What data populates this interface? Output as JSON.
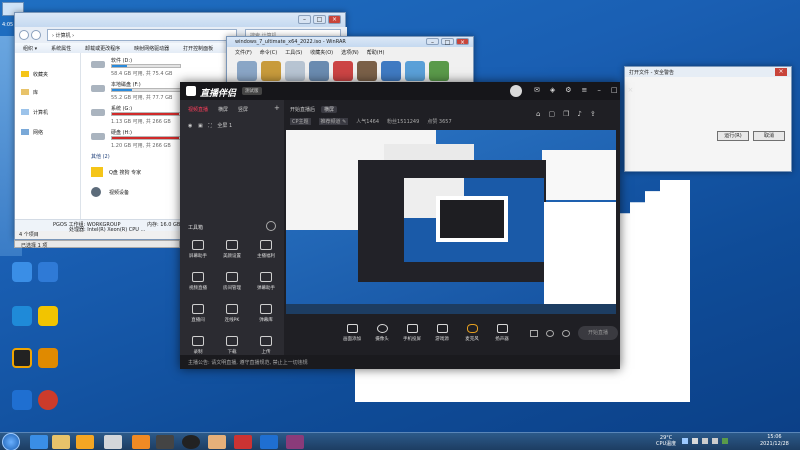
{
  "desktop": {
    "top_icon_label": "4:05",
    "icons": [
      {
        "label": "",
        "color": "#3a8ee6"
      },
      {
        "label": "",
        "color": "#2f7ad6"
      },
      {
        "label": "",
        "color": "#2b8a3e"
      },
      {
        "label": "",
        "color": "#f2a900"
      },
      {
        "label": "",
        "color": "#222222"
      },
      {
        "label": "",
        "color": "#e08a00"
      },
      {
        "label": "",
        "color": "#1f6fd1"
      },
      {
        "label": "",
        "color": "#cc3b2b"
      }
    ]
  },
  "explorer": {
    "address": "› 计算机 ›",
    "search_placeholder": "搜索 计算机",
    "menu": [
      "组织 ▾",
      "系统属性",
      "卸载或更改程序",
      "映射网络驱动器",
      "打开控制面板"
    ],
    "sidebar": [
      "收藏夹",
      "库",
      "计算机",
      "网络"
    ],
    "drives": [
      {
        "name": "软件 (D:)",
        "size": "58.4 GB 可用, 共 75.4 GB",
        "fill": 0.22,
        "bar": "#2a8adb"
      },
      {
        "name": "本地磁盘 (F:)",
        "size": "55.2 GB 可用, 共 77.7 GB",
        "fill": 0.29,
        "bar": "#2a8adb"
      },
      {
        "name": "系统 (G:)",
        "size": "1.13 GB 可用, 共 266 GB",
        "fill": 0.99,
        "bar": "#d02a2a"
      },
      {
        "name": "硬盘 (H:)",
        "size": "1.20 GB 可用, 共 266 GB",
        "fill": 0.99,
        "bar": "#d02a2a"
      }
    ],
    "other_section": "其他 (2)",
    "other": [
      "Q盘 搜狗 专家",
      "视频设备"
    ],
    "pc_name": "PGOS  工作组: WORKGROUP",
    "pc_cpu": "处理器: Intel(R) Xeon(R) CPU ...",
    "pc_mem": "内存: 16.0 GB",
    "status_top": "4 个项目",
    "status_bottom": "已选择 1 项"
  },
  "winrar": {
    "title": "windows_7_ultimate_x64_2022.iso - WinRAR",
    "menu": [
      "文件(F)",
      "命令(C)",
      "工具(S)",
      "收藏夹(O)",
      "选项(N)",
      "帮助(H)"
    ],
    "tools": [
      "添加",
      "解压到",
      "测试",
      "查看",
      "删除",
      "查找",
      "向导",
      "信息",
      "修复",
      "自解压格式"
    ]
  },
  "dialog": {
    "title": "打开文件 - 安全警告",
    "ok": "运行(R)",
    "cancel": "取消"
  },
  "zhibo": {
    "brand": "直播伴侣",
    "version": "测试版",
    "scene_tabs": [
      "视频直播",
      "横屏",
      "竖屏"
    ],
    "left_small": [
      "全屏 1"
    ],
    "section": "工具箱",
    "tools": [
      "屏幕助手",
      "美颜设置",
      "主播福利",
      "视频直播",
      "房间管理",
      "弹幕助手",
      "直播间",
      "连线PK",
      "弹幕库",
      "录制",
      "下载",
      "上传"
    ],
    "title_info": "开始直播后",
    "tag": "横屏",
    "room_info": [
      "CP主题",
      "推荐频道 ✎",
      "人气1464",
      "粉丝1511249",
      "点赞 3657"
    ],
    "bottom_tools": [
      "画面添加",
      "摄像头",
      "手机投屏",
      "游戏源",
      "麦克风",
      "扬声器"
    ],
    "start_button": "开始直播",
    "footer": "主播公告: 请文明直播, 遵守直播规范, 禁止上一切违规"
  },
  "taskbar": {
    "clock_time": "15:06",
    "clock_date": "2021/12/28",
    "tray": [
      "29°C",
      "CPU温度"
    ]
  }
}
